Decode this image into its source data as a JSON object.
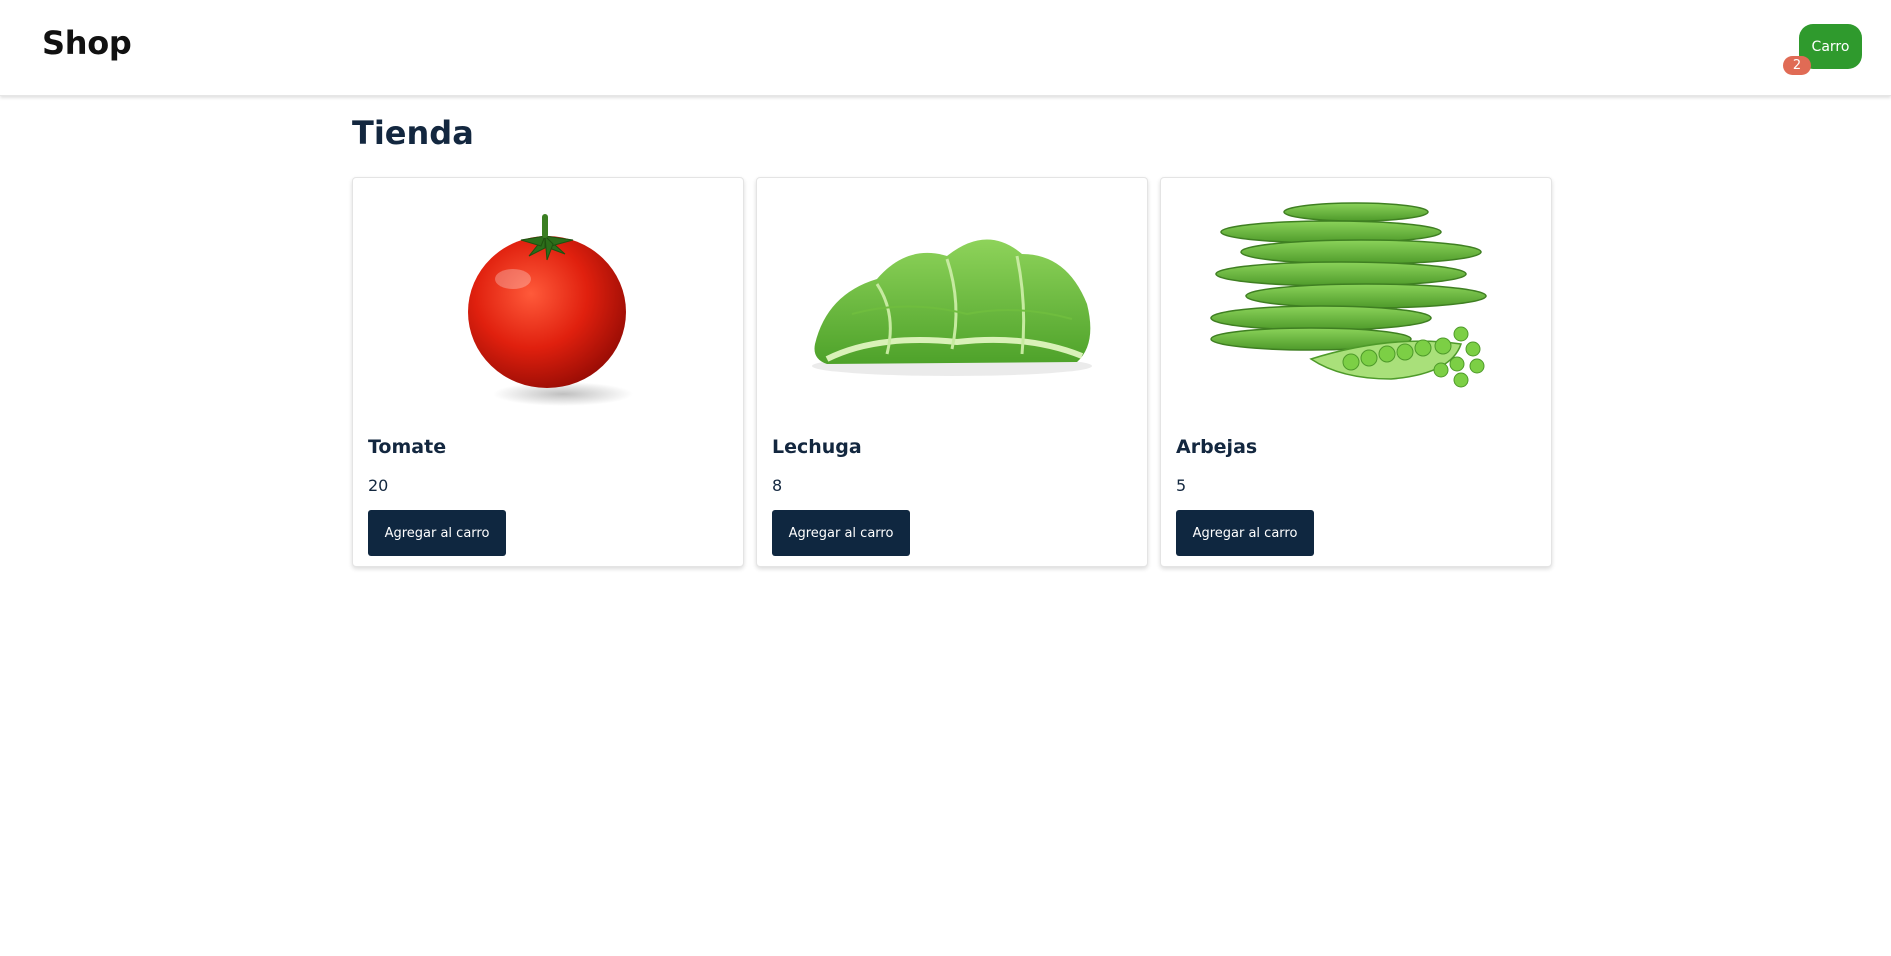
{
  "header": {
    "logo": "Shop",
    "cart_label": "Carro",
    "cart_count": "2",
    "cart_color": "#2f9a2d",
    "badge_color": "#e06b55"
  },
  "main": {
    "title": "Tienda",
    "products": [
      {
        "name": "Tomate",
        "price": "20",
        "button_label": "Agregar al carro",
        "image": "tomato-image"
      },
      {
        "name": "Lechuga",
        "price": "8",
        "button_label": "Agregar al carro",
        "image": "lettuce-image"
      },
      {
        "name": "Arbejas",
        "price": "5",
        "button_label": "Agregar al carro",
        "image": "peas-image"
      }
    ]
  },
  "colors": {
    "accent_dark": "#0f2740",
    "text": "#13273f"
  }
}
